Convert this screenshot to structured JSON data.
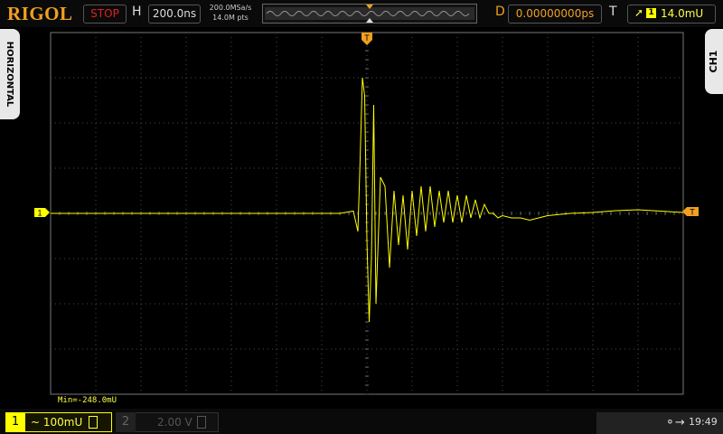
{
  "header": {
    "logo": "RIGOL",
    "run_state": "STOP",
    "horizontal_label": "H",
    "timebase": "200.0ns",
    "sample_rate": "200.0MSa/s",
    "memory_depth": "14.0M pts",
    "delay_label": "D",
    "delay_value": "0.00000000ps",
    "trigger_label": "T",
    "trigger_source": "1",
    "trigger_level": "14.0mU"
  },
  "side_tabs": {
    "left": "HORIZONTAL",
    "right": "CH1"
  },
  "markers": {
    "trigger_time": "T",
    "channel_ground": "1",
    "trigger_level": "T"
  },
  "measurement": {
    "min_text": "Min=-248.0mU"
  },
  "channels": [
    {
      "num": "1",
      "coupling": "~",
      "scale": "100mU"
    },
    {
      "num": "2",
      "scale": "2.00 V"
    }
  ],
  "status": {
    "usb_icon": "usb-icon",
    "time": "19:49"
  },
  "colors": {
    "ch1": "#ffff00",
    "trigger": "#f0a020",
    "stop": "#e02020",
    "grid": "#4a4a4a"
  },
  "chart_data": {
    "type": "line",
    "title": "",
    "xlabel": "",
    "ylabel": "",
    "grid": true,
    "x_divisions": 14,
    "y_divisions": 8,
    "x_unit_per_div": "200.0ns",
    "y_unit_per_div": "100mU",
    "xlim_div": [
      -7,
      7
    ],
    "ylim_div": [
      -4,
      4
    ],
    "series": [
      {
        "x_div": [
          -7,
          -6.5,
          -6,
          -5.5,
          -5,
          -4.5,
          -4,
          -3.5,
          -3,
          -2.5,
          -2,
          -1.5,
          -1,
          -0.6,
          -0.3,
          -0.2,
          -0.15,
          -0.1,
          -0.05,
          0,
          0.05,
          0.1,
          0.15,
          0.2,
          0.3,
          0.4,
          0.5,
          0.6,
          0.7,
          0.8,
          0.9,
          1.0,
          1.1,
          1.2,
          1.3,
          1.4,
          1.5,
          1.6,
          1.7,
          1.8,
          1.9,
          2.0,
          2.1,
          2.2,
          2.3,
          2.4,
          2.5,
          2.6,
          2.7,
          2.8,
          2.9,
          3.0,
          3.2,
          3.4,
          3.6,
          3.8,
          4.0,
          4.5,
          5.0,
          5.5,
          6.0,
          6.5,
          7
        ],
        "y_div": [
          0,
          0,
          0,
          0,
          0,
          0,
          0,
          0,
          0,
          0,
          0,
          0,
          0,
          0,
          0.05,
          -0.4,
          1.2,
          3.0,
          2.6,
          -0.6,
          -2.4,
          -1.0,
          2.4,
          -2.0,
          0.8,
          0.6,
          -1.2,
          0.5,
          -0.7,
          0.4,
          -0.8,
          0.5,
          -0.5,
          0.6,
          -0.4,
          0.6,
          -0.3,
          0.5,
          -0.2,
          0.5,
          -0.2,
          0.4,
          -0.2,
          0.4,
          -0.1,
          0.3,
          -0.1,
          0.2,
          0,
          0,
          -0.1,
          -0.05,
          -0.1,
          -0.1,
          -0.15,
          -0.1,
          -0.05,
          0,
          0.02,
          0.06,
          0.08,
          0.05,
          0.02
        ]
      }
    ]
  }
}
